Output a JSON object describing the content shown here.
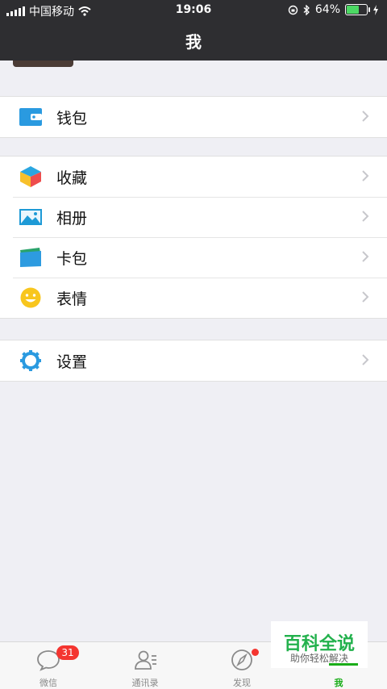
{
  "status_bar": {
    "carrier": "中国移动",
    "time": "19:06",
    "battery": "64%",
    "battery_level": 0.64
  },
  "header": {
    "title": "我"
  },
  "menu_groups": [
    {
      "items": [
        {
          "label": "钱包",
          "icon": "wallet-icon"
        }
      ]
    },
    {
      "items": [
        {
          "label": "收藏",
          "icon": "favorites-cube-icon"
        },
        {
          "label": "相册",
          "icon": "photo-album-icon"
        },
        {
          "label": "卡包",
          "icon": "card-wallet-icon"
        },
        {
          "label": "表情",
          "icon": "smiley-face-icon"
        }
      ]
    },
    {
      "items": [
        {
          "label": "设置",
          "icon": "settings-gear-icon"
        }
      ]
    }
  ],
  "tab_bar": {
    "tabs": [
      {
        "label": "微信",
        "icon": "chat-bubble-icon",
        "badge": "31"
      },
      {
        "label": "通讯录",
        "icon": "contacts-icon"
      },
      {
        "label": "发现",
        "icon": "compass-icon",
        "dot": true
      },
      {
        "label": "我",
        "icon": "person-icon",
        "active": true
      }
    ]
  },
  "watermark": {
    "title": "百科全说",
    "subtitle": "助你轻松解决"
  },
  "colors": {
    "accent_green": "#1aad19",
    "badge_red": "#f43530",
    "header_bg": "#2e2e31",
    "page_bg": "#efeff4"
  }
}
